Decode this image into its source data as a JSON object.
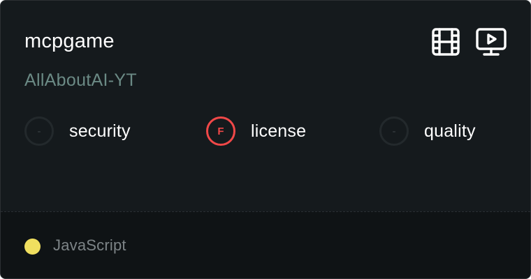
{
  "repo": {
    "name": "mcpgame",
    "owner": "AllAboutAI-YT"
  },
  "actions": [
    {
      "icon": "film-icon"
    },
    {
      "icon": "video-player-icon"
    }
  ],
  "scores": [
    {
      "grade": "-",
      "label": "security",
      "status": "none"
    },
    {
      "grade": "F",
      "label": "license",
      "status": "fail"
    },
    {
      "grade": "-",
      "label": "quality",
      "status": "none"
    }
  ],
  "language": {
    "name": "JavaScript",
    "color": "#f0df5f"
  },
  "colors": {
    "background": "#151a1d",
    "footer": "#0f1315",
    "owner_text": "#6b8a85",
    "fail": "#f04848"
  }
}
